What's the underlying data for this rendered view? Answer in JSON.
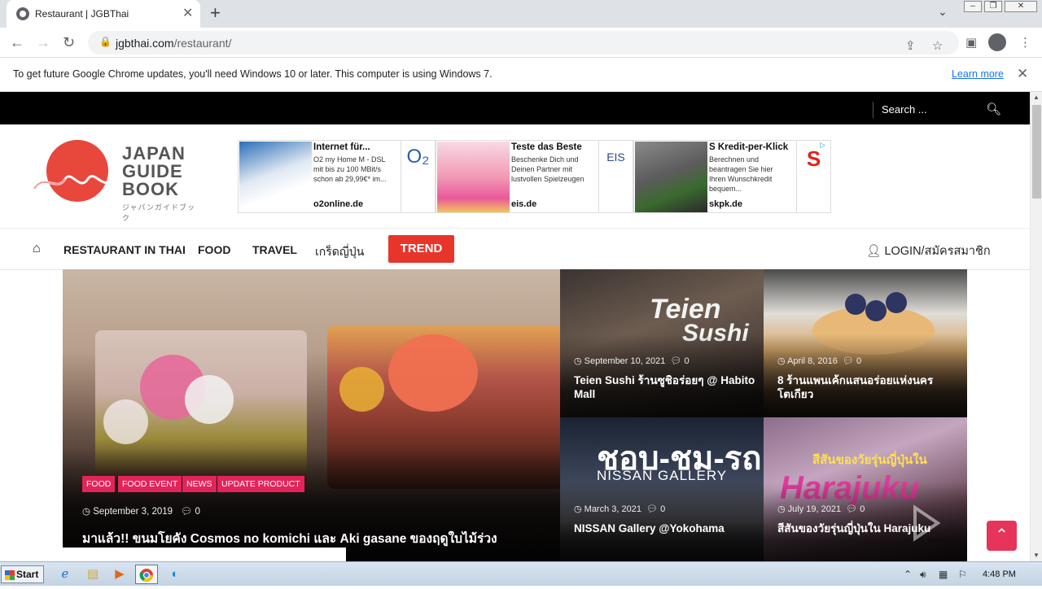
{
  "browser": {
    "tab_title": "Restaurant | JGBThai",
    "new_tab": "+",
    "tab_close": "✕",
    "url_host": "jgbthai.com",
    "url_path": "/restaurant/"
  },
  "infobar": {
    "message": "To get future Google Chrome updates, you'll need Windows 10 or later. This computer is using Windows 7.",
    "link": "Learn more"
  },
  "site": {
    "search_placeholder": "Search ...",
    "logo": {
      "line1": "JAPAN",
      "line2": "GUIDE",
      "line3": "BOOK",
      "sub": "ジャパンガイドブック"
    },
    "ads": [
      {
        "headline": "Internet für...",
        "body": "O2 my Home M - DSL mit bis zu 100 MBit/s schon ab 29,99€* im...",
        "domain": "o2online.de",
        "brand": "O₂"
      },
      {
        "headline": "Teste das Beste",
        "body": "Beschenke Dich und Deinen Partner mit lustvollen Spielzeugen",
        "domain": "eis.de",
        "brand": "EIS"
      },
      {
        "headline": "S Kredit-per-Klick",
        "body": "Berechnen und beantragen Sie hier Ihren Wunschkredit bequem...",
        "domain": "skpk.de",
        "brand": "S"
      }
    ],
    "nav": {
      "items": [
        "RESTAURANT IN THAI",
        "FOOD",
        "TRAVEL",
        "เกร็ดญี่ปุ่น"
      ],
      "trend": "TREND",
      "login": "LOGIN/สมัครสมาชิก"
    },
    "hero": {
      "tags": [
        "FOOD",
        "FOOD EVENT",
        "NEWS",
        "UPDATE PRODUCT"
      ],
      "date": "September 3, 2019",
      "comments": "0",
      "title": "มาแล้ว!! ขนมโยคัง Cosmos no komichi และ Aki gasane ของฤดูใบไม้ร่วง"
    },
    "tiles": [
      {
        "date": "September 10, 2021",
        "comments": "0",
        "title": "Teien Sushi ร้านซูชิอร่อยๆ @ Habito Mall",
        "art1": "Teien",
        "art2": "Sushi"
      },
      {
        "date": "April 8, 2016",
        "comments": "0",
        "title": "8 ร้านแพนเค้กแสนอร่อยแห่งนครโตเกียว"
      },
      {
        "date": "March 3, 2021",
        "comments": "0",
        "title": "NISSAN Gallery @Yokohama",
        "art1": "ชอบ-ชม-รถ",
        "art2": "NISSAN GALLERY"
      },
      {
        "date": "July 19, 2021",
        "comments": "0",
        "title": "สีสันของวัยรุ่นญี่ปุ่นใน Harajuku",
        "art1": "Harajuku",
        "art2": "สีสันของวัยรุ่นญี่ปุ่นใน"
      }
    ]
  },
  "taskbar": {
    "start": "Start",
    "time": "4:48 PM"
  },
  "colors": {
    "accent_red": "#e8352a",
    "tag_pink": "#e3245a",
    "topbar": "#000000"
  }
}
